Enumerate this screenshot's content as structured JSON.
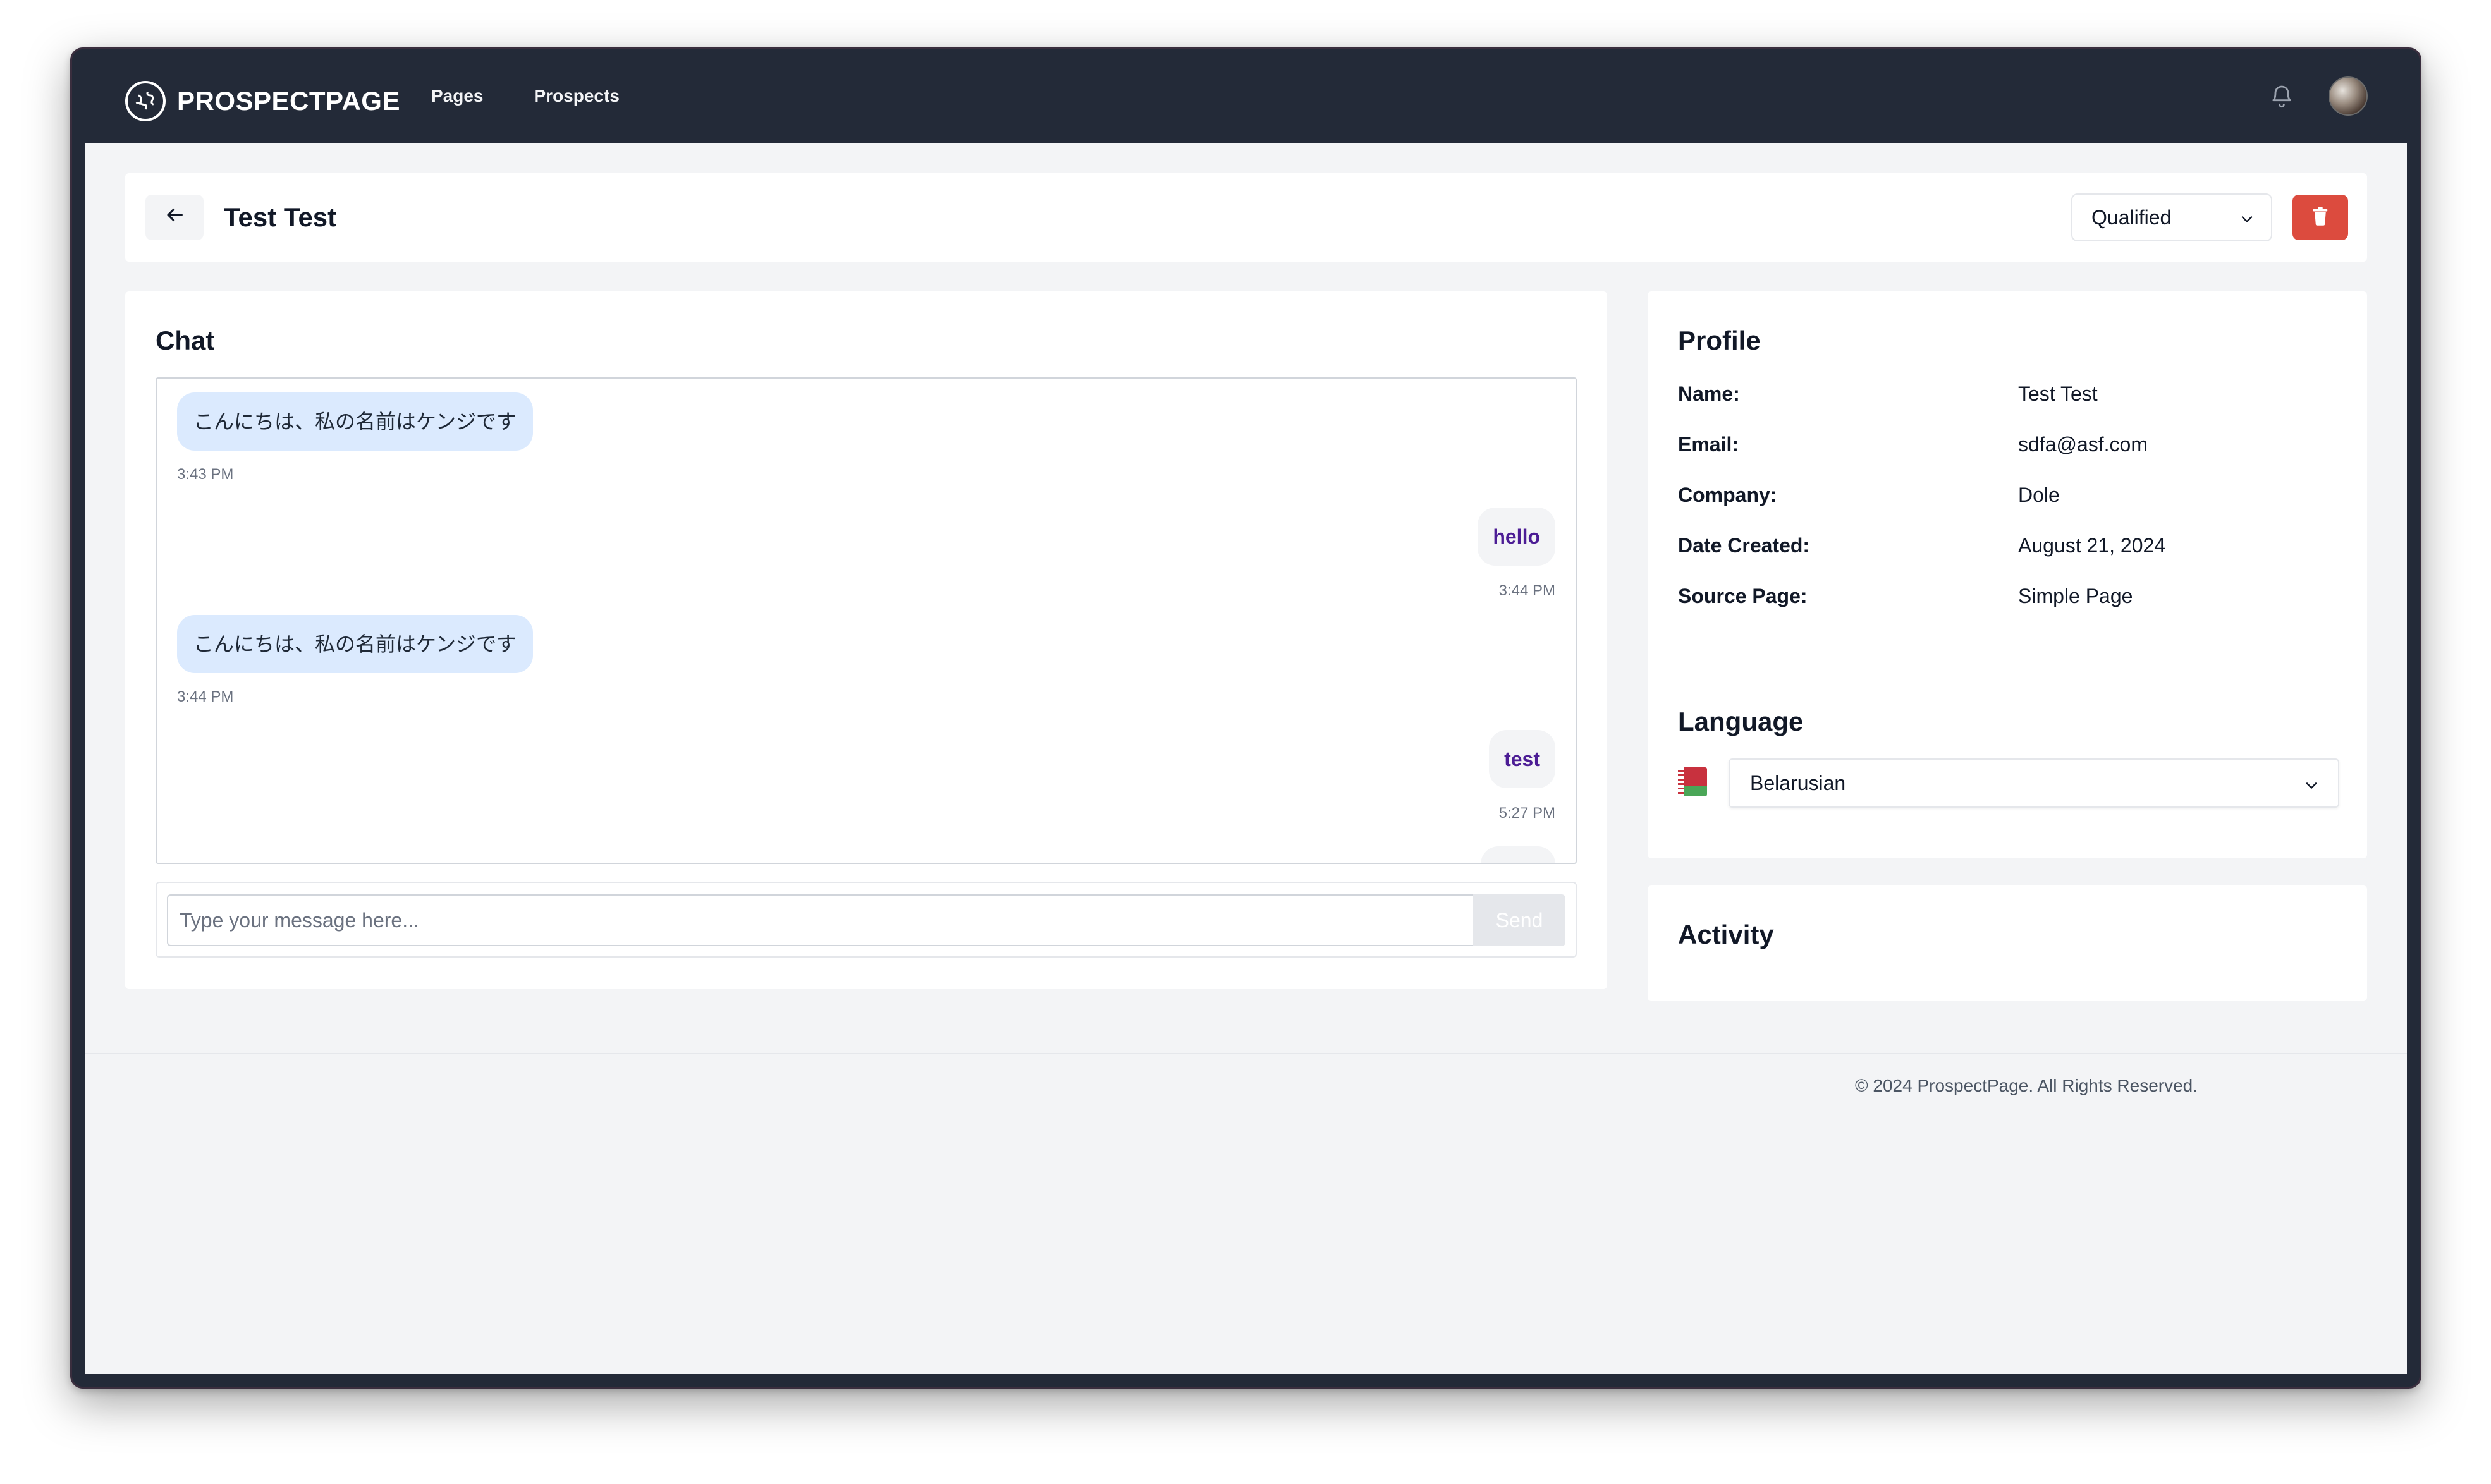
{
  "nav": {
    "brand": "PROSPECTPAGE",
    "links": [
      "Pages",
      "Prospects"
    ]
  },
  "header": {
    "title": "Test Test",
    "back_icon": "arrow-left-icon",
    "status_value": "Qualified",
    "delete_icon": "trash-icon"
  },
  "chat": {
    "title": "Chat",
    "messages": [
      {
        "direction": "incoming",
        "text": "こんにちは、私の名前はケンジです",
        "time": "3:43 PM"
      },
      {
        "direction": "outgoing",
        "text": "hello",
        "time": "3:44 PM"
      },
      {
        "direction": "incoming",
        "text": "こんにちは、私の名前はケンジです",
        "time": "3:44 PM"
      },
      {
        "direction": "outgoing",
        "text": "test",
        "time": "5:27 PM"
      }
    ],
    "input_placeholder": "Type your message here...",
    "send_label": "Send"
  },
  "profile": {
    "title": "Profile",
    "fields": [
      {
        "label": "Name:",
        "value": "Test Test"
      },
      {
        "label": "Email:",
        "value": "sdfa@asf.com"
      },
      {
        "label": "Company:",
        "value": "Dole"
      },
      {
        "label": "Date Created:",
        "value": "August 21, 2024"
      },
      {
        "label": "Source Page:",
        "value": "Simple Page"
      }
    ]
  },
  "language": {
    "title": "Language",
    "selected": "Belarusian",
    "flag_icon": "belarus-flag-icon"
  },
  "activity": {
    "title": "Activity"
  },
  "footer": {
    "copyright": "© 2024 ProspectPage. All Rights Reserved."
  },
  "colors": {
    "nav_bg": "#232a38",
    "page_bg": "#f3f4f6",
    "incoming_bubble": "#dbeafe",
    "outgoing_text": "#4c1d95",
    "delete_red": "#dc4b3e"
  }
}
